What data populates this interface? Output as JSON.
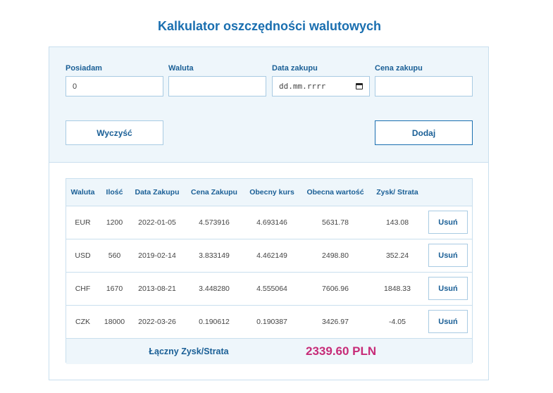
{
  "title": "Kalkulator oszczędności walutowych",
  "form": {
    "have_label": "Posiadam",
    "have_value": "0",
    "currency_label": "Waluta",
    "currency_value": "",
    "date_label": "Data zakupu",
    "date_placeholder": "dd.mm.rrrr",
    "price_label": "Cena zakupu",
    "price_value": "",
    "clear_label": "Wyczyść",
    "add_label": "Dodaj"
  },
  "table": {
    "headers": [
      "Waluta",
      "Ilość",
      "Data Zakupu",
      "Cena Zakupu",
      "Obecny kurs",
      "Obecna wartość",
      "Zysk/ Strata"
    ],
    "rows": [
      {
        "currency": "EUR",
        "amount": "1200",
        "date": "2022-01-05",
        "buy_price": "4.573916",
        "current_rate": "4.693146",
        "current_value": "5631.78",
        "profit": "143.08",
        "delete_label": "Usuń"
      },
      {
        "currency": "USD",
        "amount": "560",
        "date": "2019-02-14",
        "buy_price": "3.833149",
        "current_rate": "4.462149",
        "current_value": "2498.80",
        "profit": "352.24",
        "delete_label": "Usuń"
      },
      {
        "currency": "CHF",
        "amount": "1670",
        "date": "2013-08-21",
        "buy_price": "3.448280",
        "current_rate": "4.555064",
        "current_value": "7606.96",
        "profit": "1848.33",
        "delete_label": "Usuń"
      },
      {
        "currency": "CZK",
        "amount": "18000",
        "date": "2022-03-26",
        "buy_price": "0.190612",
        "current_rate": "0.190387",
        "current_value": "3426.97",
        "profit": "-4.05",
        "delete_label": "Usuń"
      }
    ],
    "total_label": "Łączny Zysk/Strata",
    "total_value": "2339.60 PLN"
  },
  "colors": {
    "accent": "#1a6fb0",
    "panel_bg": "#eef6fb",
    "border": "#c9dfee",
    "total_value": "#c72c78"
  }
}
